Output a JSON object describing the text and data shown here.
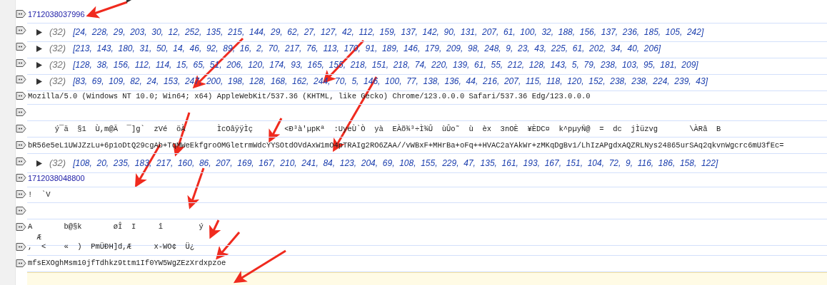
{
  "console": {
    "rows": [
      {
        "kind": "prototype"
      },
      {
        "kind": "number",
        "text": "1712038037996"
      },
      {
        "kind": "array",
        "count": "(32)",
        "text": "[24, 228, 29, 203, 30, 12, 252, 135, 215, 144, 29, 62, 27, 127, 42, 112, 159, 137, 142, 90, 131, 207, 61, 100, 32, 188, 156, 137, 236, 185, 105, 242]"
      },
      {
        "kind": "array",
        "count": "(32)",
        "text": "[213, 143, 180, 31, 50, 14, 46, 92, 89, 16, 2, 70, 217, 76, 113, 170, 91, 189, 146, 179, 209, 98, 248, 9, 23, 43, 225, 61, 202, 34, 40, 206]"
      },
      {
        "kind": "array",
        "count": "(32)",
        "text": "[128, 38, 156, 112, 114, 15, 65, 51, 206, 120, 174, 93, 165, 155, 218, 151, 218, 74, 220, 139, 61, 55, 212, 128, 143, 5, 79, 238, 103, 95, 181, 209]"
      },
      {
        "kind": "array",
        "count": "(32)",
        "text": "[83, 69, 109, 82, 24, 153, 247, 200, 198, 128, 168, 162, 244, 70, 5, 146, 100, 77, 138, 136, 44, 216, 207, 115, 118, 120, 152, 238, 238, 224, 239, 43]"
      },
      {
        "kind": "string",
        "text": "Mozilla/5.0 (Windows NT 10.0; Win64; x64) AppleWebKit/537.36 (KHTML, like Gecko) Chrome/123.0.0.0 Safari/537.36 Edg/123.0.0.0"
      },
      {
        "kind": "empty"
      },
      {
        "kind": "string",
        "text": "      ý¯ä  §1  Ù,m@Ã  ¯]g`  zVé  öÀ       ÌcOâÿÿÌç       <Ð³à'µpKª  :UyeÙ`Ò  yà  EÀõ¾³÷Ì¾Û  ùÛo˜  ù  èx  3nOÈ  ¥ÈDC¤  k^pµyÑ@  =  dc  jÌüzvg       \\ÀRâ  B"
      },
      {
        "kind": "string",
        "text": "bR56e5eL1UWJZzLu+6p1oDtQ29cgAb+TqMWeEkfgroOMGletrmWdcYYSOtdOVdAxW1mO4pTRAIg2RO6ZAA//vWBxF+MHrBa+oFq++HVAC2aYAkWr+zMKqDgBv1/LhIzAPgdxAQZRLNys24865urSAq2qkvnWgcrc6mU3fEc="
      },
      {
        "kind": "array",
        "count": "(32)",
        "text": "[108, 20, 235, 183, 217, 160, 86, 207, 169, 167, 210, 241, 84, 123, 204, 69, 108, 155, 229, 47, 135, 161, 193, 167, 151, 104, 72, 9, 116, 186, 158, 122]"
      },
      {
        "kind": "number",
        "text": "1712038048800"
      },
      {
        "kind": "string",
        "text": "!  `V"
      },
      {
        "kind": "empty"
      },
      {
        "kind": "string",
        "text": "A       b@§k       øÎ  I     î        ý\n  Æ"
      },
      {
        "kind": "string",
        "text": ",  <    «  )  PmÜÐH]d,Æ     x-WO¢  Ü¿"
      },
      {
        "kind": "string",
        "text": "mfsEXOghMsm10jfTdhkz9ttm1If0YW5WgZEzXrdxpzoe"
      },
      {
        "kind": "warning"
      }
    ]
  }
}
